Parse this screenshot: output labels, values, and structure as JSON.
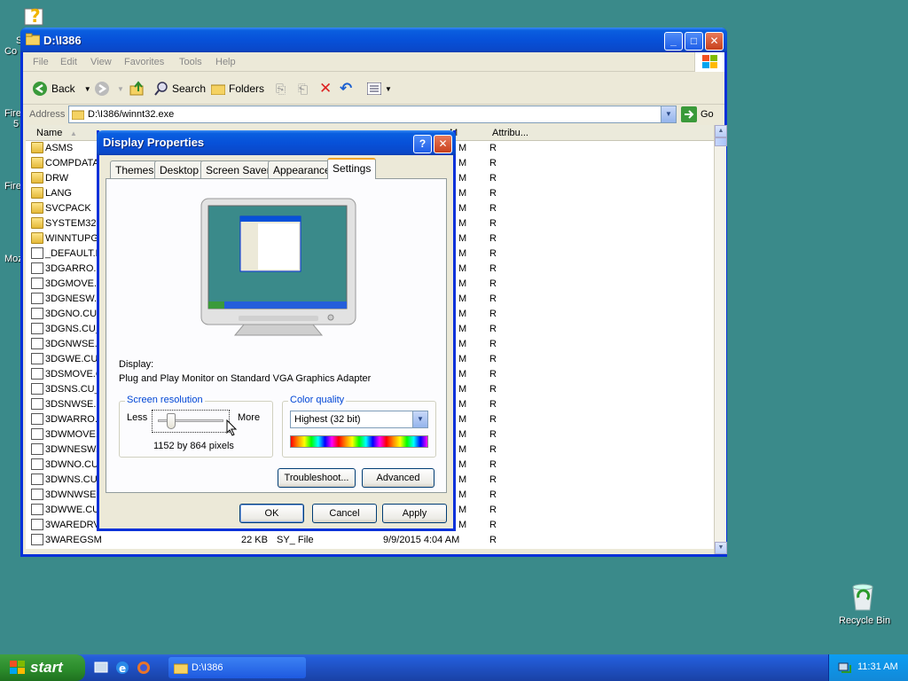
{
  "desktop": {
    "icons": [
      {
        "label": "S",
        "label2": "Co"
      },
      {
        "label": "Fire",
        "label2": "5"
      },
      {
        "label": "Fire"
      },
      {
        "label": "Moz"
      }
    ],
    "recycle_bin": "Recycle Bin"
  },
  "explorer": {
    "title": "D:\\I386",
    "menu": [
      "File",
      "Edit",
      "View",
      "Favorites",
      "Tools",
      "Help"
    ],
    "toolbar": {
      "back": "Back",
      "search": "Search",
      "folders": "Folders"
    },
    "address_label": "Address",
    "address_value": "D:\\I386/winnt32.exe",
    "go": "Go",
    "columns": {
      "name": "Name",
      "modified": "M",
      "attributes": "Attribu..."
    },
    "files": [
      {
        "name": "ASMS",
        "folder": true,
        "mod": "M",
        "attr": "R"
      },
      {
        "name": "COMPDATA",
        "folder": true,
        "mod": "M",
        "attr": "R"
      },
      {
        "name": "DRW",
        "folder": true,
        "mod": "M",
        "attr": "R"
      },
      {
        "name": "LANG",
        "folder": true,
        "mod": "M",
        "attr": "R"
      },
      {
        "name": "SVCPACK",
        "folder": true,
        "mod": "M",
        "attr": "R"
      },
      {
        "name": "SYSTEM32",
        "folder": true,
        "mod": "M",
        "attr": "R"
      },
      {
        "name": "WINNTUPG",
        "folder": true,
        "mod": "M",
        "attr": "R"
      },
      {
        "name": "_DEFAULT.P",
        "folder": false,
        "mod": "M",
        "attr": "R"
      },
      {
        "name": "3DGARRO.C",
        "folder": false,
        "mod": "M",
        "attr": "R"
      },
      {
        "name": "3DGMOVE.C",
        "folder": false,
        "mod": "M",
        "attr": "R"
      },
      {
        "name": "3DGNESW.C",
        "folder": false,
        "mod": "M",
        "attr": "R"
      },
      {
        "name": "3DGNO.CU_",
        "folder": false,
        "mod": "M",
        "attr": "R"
      },
      {
        "name": "3DGNS.CU_",
        "folder": false,
        "mod": "M",
        "attr": "R"
      },
      {
        "name": "3DGNWSE.C",
        "folder": false,
        "mod": "M",
        "attr": "R"
      },
      {
        "name": "3DGWE.CU_",
        "folder": false,
        "mod": "M",
        "attr": "R"
      },
      {
        "name": "3DSMOVE.C",
        "folder": false,
        "mod": "M",
        "attr": "R"
      },
      {
        "name": "3DSNS.CU_",
        "folder": false,
        "mod": "M",
        "attr": "R"
      },
      {
        "name": "3DSNWSE.C",
        "folder": false,
        "mod": "M",
        "attr": "R"
      },
      {
        "name": "3DWARRO.C",
        "folder": false,
        "mod": "M",
        "attr": "R"
      },
      {
        "name": "3DWMOVE.C",
        "folder": false,
        "mod": "M",
        "attr": "R"
      },
      {
        "name": "3DWNESW.C",
        "folder": false,
        "mod": "M",
        "attr": "R"
      },
      {
        "name": "3DWNO.CU_",
        "folder": false,
        "mod": "M",
        "attr": "R"
      },
      {
        "name": "3DWNS.CU_",
        "folder": false,
        "mod": "M",
        "attr": "R"
      },
      {
        "name": "3DWNWSE.C",
        "folder": false,
        "mod": "M",
        "attr": "R"
      },
      {
        "name": "3DWWE.CU_",
        "folder": false,
        "mod": "M",
        "attr": "R"
      },
      {
        "name": "3WAREDRV",
        "folder": false,
        "mod": "M",
        "attr": "R"
      },
      {
        "name": "3WAREGSM",
        "folder": false,
        "size": "22 KB",
        "type": "SY_ File",
        "date": "9/9/2015 4:04 AM",
        "attr": "R"
      }
    ]
  },
  "dialog": {
    "title": "Display Properties",
    "help": "?",
    "tabs": [
      "Themes",
      "Desktop",
      "Screen Saver",
      "Appearance",
      "Settings"
    ],
    "display_label": "Display:",
    "display_value": "Plug and Play Monitor on Standard VGA Graphics Adapter",
    "resolution": {
      "group": "Screen resolution",
      "less": "Less",
      "more": "More",
      "value": "1152 by 864 pixels",
      "slider_fraction": 0.15
    },
    "color": {
      "group": "Color quality",
      "value": "Highest (32 bit)"
    },
    "buttons": {
      "troubleshoot": "Troubleshoot...",
      "advanced": "Advanced",
      "ok": "OK",
      "cancel": "Cancel",
      "apply": "Apply"
    }
  },
  "taskbar": {
    "start": "start",
    "task": "D:\\I386",
    "clock": "11:31 AM"
  }
}
